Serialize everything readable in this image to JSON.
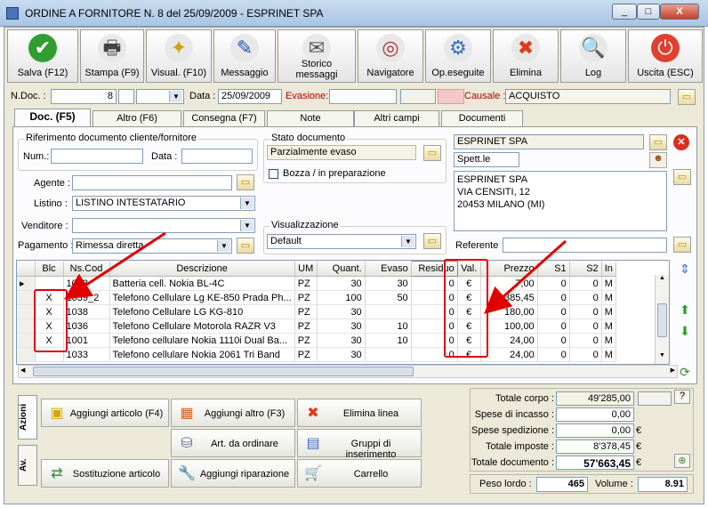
{
  "window": {
    "title": "ORDINE A FORNITORE N. 8  del 25/09/2009 - ESPRINET SPA",
    "min": "_",
    "max": "□",
    "close": "X"
  },
  "toolbar": [
    {
      "name": "save-button",
      "label": "Salva (F12)",
      "icon": "✔",
      "color": "#2f9e2f",
      "fg": "#fff"
    },
    {
      "name": "print-button",
      "label": "Stampa (F9)",
      "icon": "🖶",
      "color": "#e8e8e8",
      "fg": "#444"
    },
    {
      "name": "view-button",
      "label": "Visual. (F10)",
      "icon": "✦",
      "color": "#e8e8e8",
      "fg": "#d4a000"
    },
    {
      "name": "message-button",
      "label": "Messaggio",
      "icon": "✎",
      "color": "#e8e8e8",
      "fg": "#2050c0"
    },
    {
      "name": "message-history-button",
      "label": "Storico\nmessaggi",
      "icon": "✉",
      "color": "#e8e8e8",
      "fg": "#555"
    },
    {
      "name": "navigator-button",
      "label": "Navigatore",
      "icon": "◎",
      "color": "#e8e8e8",
      "fg": "#b03030"
    },
    {
      "name": "executed-ops-button",
      "label": "Op.eseguite",
      "icon": "⚙",
      "color": "#e8e8e8",
      "fg": "#3070c0"
    },
    {
      "name": "delete-button",
      "label": "Elimina",
      "icon": "✖",
      "color": "#e8e8e8",
      "fg": "#e03a1a"
    },
    {
      "name": "log-button",
      "label": "Log",
      "icon": "🔍",
      "color": "#e8e8e8",
      "fg": "#2050a0"
    },
    {
      "name": "exit-button",
      "label": "Uscita (ESC)",
      "icon": "⏻",
      "color": "#e04030",
      "fg": "#fff"
    }
  ],
  "header": {
    "ndoc_label": "N.Doc. :",
    "ndoc_value": "8",
    "data_label": "Data :",
    "data_value": "25/09/2009",
    "evasione_label": "Evasione:",
    "causale_label": "Causale :",
    "causale_value": "ACQUISTO"
  },
  "tabs": [
    "Doc. (F5)",
    "Altro (F6)",
    "Consegna (F7)",
    "Note",
    "Altri campi",
    "Documenti"
  ],
  "riferimento": {
    "title": "Riferimento documento cliente/fornitore",
    "num_label": "Num.:",
    "data_label": "Data :"
  },
  "stato": {
    "title": "Stato documento",
    "value": "Parzialmente evaso",
    "bozza_label": "Bozza / in preparazione"
  },
  "fields": {
    "agente_label": "Agente :",
    "listino_label": "Listino :",
    "listino_value": "LISTINO INTESTATARIO",
    "venditore_label": "Venditore :",
    "pagamento_label": "Pagamento :",
    "pagamento_value": "Rimessa diretta"
  },
  "visualizzazione": {
    "title": "Visualizzazione",
    "value": "Default"
  },
  "supplier": {
    "name": "ESPRINET SPA",
    "title": "Spett.le",
    "address": [
      "ESPRINET SPA",
      "VIA CENSITI, 12",
      "20453 MILANO (MI)"
    ],
    "referente_label": "Referente"
  },
  "grid": {
    "columns": [
      "Blc",
      "Ns.Cod",
      "Descrizione",
      "UM",
      "Quant.",
      "Evaso",
      "Residuo",
      "Val.",
      "Prezzo",
      "S1",
      "S2",
      "In"
    ],
    "rows": [
      [
        "",
        "1043",
        "Batteria cell. Nokia BL-4C",
        "PZ",
        "30",
        "30",
        "0",
        "€",
        "7,00",
        "0",
        "0",
        "M"
      ],
      [
        "X",
        "1039_2",
        "Telefono Cellulare Lg KE-850 Prada Ph...",
        "PZ",
        "100",
        "50",
        "0",
        "€",
        "385,45",
        "0",
        "0",
        "M"
      ],
      [
        "X",
        "1038",
        "Telefono Cellulare LG KG-810",
        "PZ",
        "30",
        "",
        "0",
        "€",
        "180,00",
        "0",
        "0",
        "M"
      ],
      [
        "X",
        "1036",
        "Telefono Cellulare Motorola RAZR V3",
        "PZ",
        "30",
        "10",
        "0",
        "€",
        "100,00",
        "0",
        "0",
        "M"
      ],
      [
        "X",
        "1001",
        "Telefono cellulare Nokia 1110i Dual Ba...",
        "PZ",
        "30",
        "10",
        "0",
        "€",
        "24,00",
        "0",
        "0",
        "M"
      ],
      [
        "",
        "1033",
        "Telefono cellulare Nokia 2061 Tri Band",
        "PZ",
        "30",
        "",
        "0",
        "€",
        "24,00",
        "0",
        "0",
        "M"
      ]
    ]
  },
  "actions": {
    "tab_azioni": "Azioni",
    "tab_av": "Av.",
    "add_article": "Aggiungi articolo (F4)",
    "add_other": "Aggiungi altro (F3)",
    "delete_line": "Elimina linea",
    "to_order": "Art. da ordinare",
    "insert_groups": "Gruppi di inserimento",
    "substitute": "Sostituzione articolo",
    "add_repair": "Aggiungi riparazione",
    "cart": "Carrello"
  },
  "totals": [
    {
      "label": "Totale corpo :",
      "value": "49'285,00",
      "bold": false,
      "currency": ""
    },
    {
      "label": "Spese di incasso :",
      "value": "0,00",
      "bold": false,
      "currency": ""
    },
    {
      "label": "Spese spedizione :",
      "value": "0,00",
      "bold": false,
      "currency": "€"
    },
    {
      "label": "Totale imposte :",
      "value": "8'378,45",
      "bold": false,
      "currency": "€"
    },
    {
      "label": "Totale documento :",
      "value": "57'663,45",
      "bold": true,
      "currency": "€"
    }
  ],
  "totals_help": "?",
  "weights": {
    "peso_label": "Peso lordo :",
    "peso_value": "465",
    "volume_label": "Volume :",
    "volume_value": "8.91"
  },
  "colors": {
    "annotation": "#e00000"
  }
}
